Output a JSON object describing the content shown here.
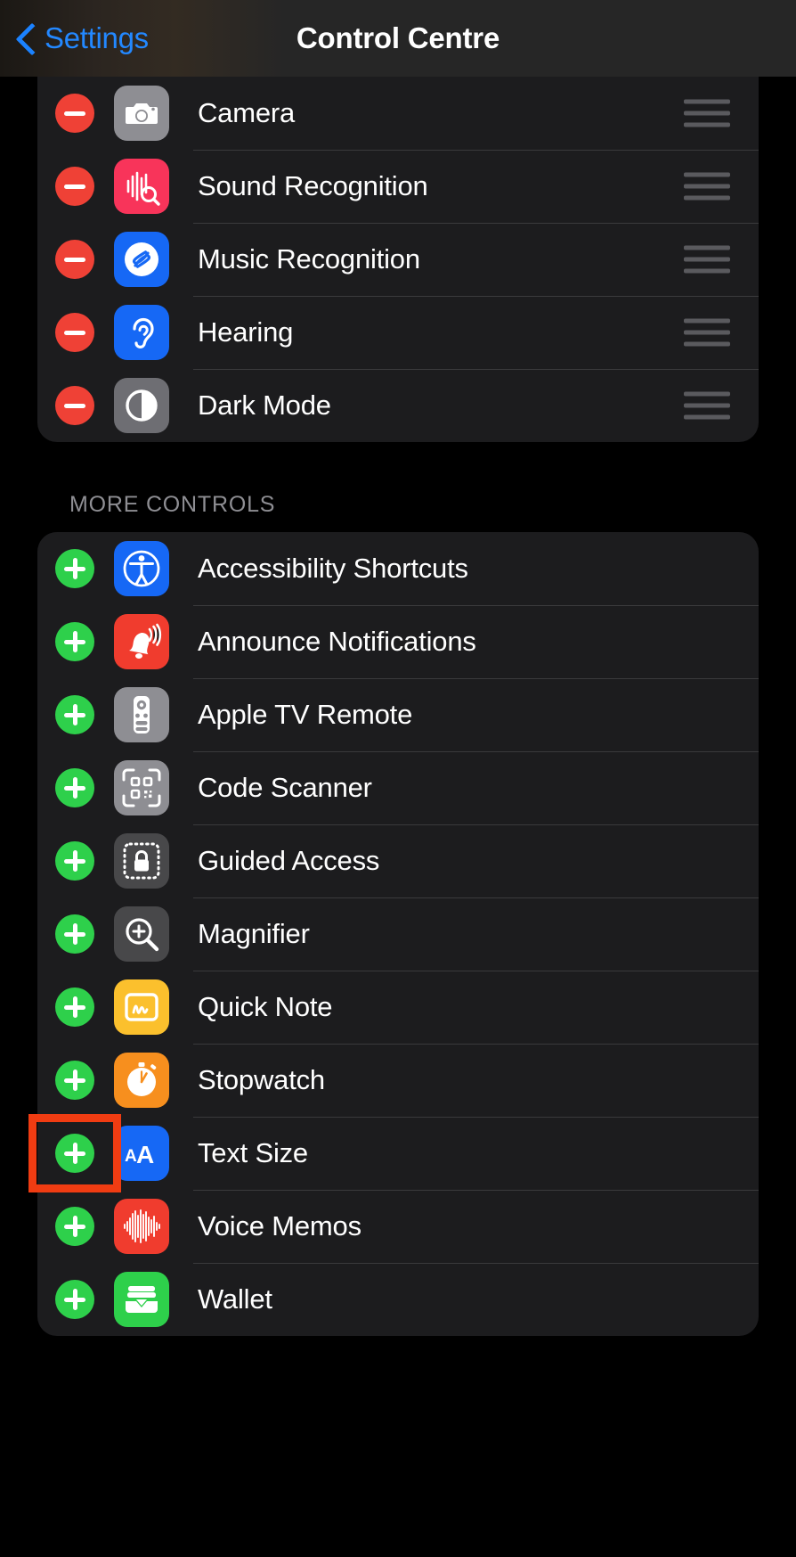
{
  "navbar": {
    "back_label": "Settings",
    "title": "Control Centre",
    "back_icon": "chevron-left-icon"
  },
  "included_section": {
    "rows": [
      {
        "label": "Camera",
        "toggle": "remove",
        "icon": "camera-icon",
        "icon_bg": "#8e8e93"
      },
      {
        "label": "Sound Recognition",
        "toggle": "remove",
        "icon": "sound-recognition-icon",
        "icon_bg": "#f8345a"
      },
      {
        "label": "Music Recognition",
        "toggle": "remove",
        "icon": "shazam-icon",
        "icon_bg": "#1668f5"
      },
      {
        "label": "Hearing",
        "toggle": "remove",
        "icon": "ear-icon",
        "icon_bg": "#1668f5"
      },
      {
        "label": "Dark Mode",
        "toggle": "remove",
        "icon": "dark-mode-icon",
        "icon_bg": "#6e6e73"
      }
    ]
  },
  "more_controls_section": {
    "header": "MORE CONTROLS",
    "rows": [
      {
        "label": "Accessibility Shortcuts",
        "toggle": "add",
        "icon": "accessibility-icon",
        "icon_bg": "#1668f5"
      },
      {
        "label": "Announce Notifications",
        "toggle": "add",
        "icon": "bell-announce-icon",
        "icon_bg": "#f03c2e"
      },
      {
        "label": "Apple TV Remote",
        "toggle": "add",
        "icon": "tv-remote-icon",
        "icon_bg": "#8e8e93"
      },
      {
        "label": "Code Scanner",
        "toggle": "add",
        "icon": "qr-scanner-icon",
        "icon_bg": "#8e8e93"
      },
      {
        "label": "Guided Access",
        "toggle": "add",
        "icon": "guided-access-lock-icon",
        "icon_bg": "#48484a"
      },
      {
        "label": "Magnifier",
        "toggle": "add",
        "icon": "magnifier-icon",
        "icon_bg": "#48484a"
      },
      {
        "label": "Quick Note",
        "toggle": "add",
        "icon": "quick-note-icon",
        "icon_bg": "#fbc02d"
      },
      {
        "label": "Stopwatch",
        "toggle": "add",
        "icon": "stopwatch-icon",
        "icon_bg": "#f78f1e"
      },
      {
        "label": "Text Size",
        "toggle": "add",
        "icon": "text-size-icon",
        "icon_bg": "#1668f5"
      },
      {
        "label": "Voice Memos",
        "toggle": "add",
        "icon": "voice-memos-icon",
        "icon_bg": "#f03c2e"
      },
      {
        "label": "Wallet",
        "toggle": "add",
        "icon": "wallet-icon",
        "icon_bg": "#2ed04b"
      }
    ]
  },
  "annotation": {
    "highlight_color": "#f03c12",
    "target_row_label": "Text Size",
    "target_element": "add-toggle"
  }
}
